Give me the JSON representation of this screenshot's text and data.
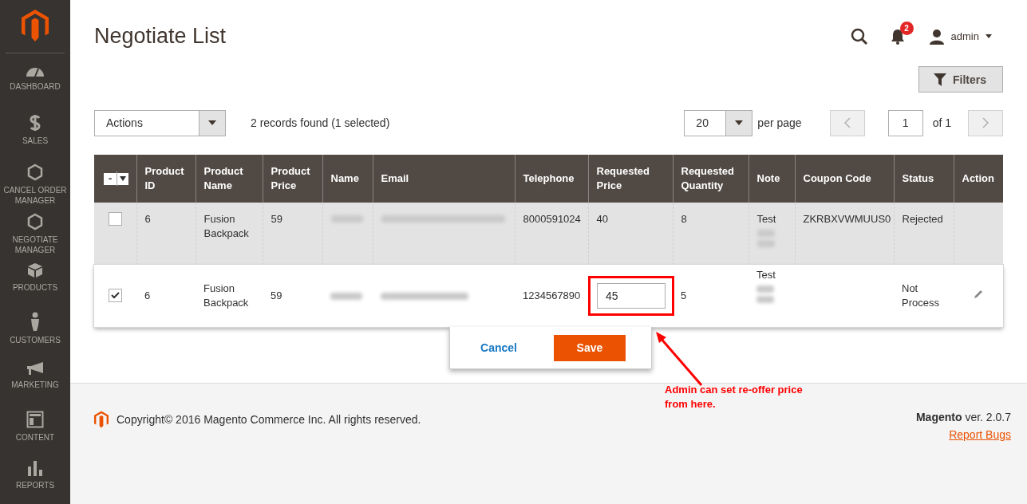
{
  "sidebar": {
    "items": [
      {
        "kind": "dashboard",
        "label": "DASHBOARD"
      },
      {
        "kind": "sales",
        "label": "SALES"
      },
      {
        "kind": "extension",
        "label": "CANCEL ORDER MANAGER"
      },
      {
        "kind": "extension",
        "label": "NEGOTIATE MANAGER"
      },
      {
        "kind": "products",
        "label": "PRODUCTS"
      },
      {
        "kind": "customers",
        "label": "CUSTOMERS"
      },
      {
        "kind": "marketing",
        "label": "MARKETING"
      },
      {
        "kind": "content",
        "label": "CONTENT"
      },
      {
        "kind": "reports",
        "label": "REPORTS"
      }
    ]
  },
  "header": {
    "title": "Negotiate List",
    "notifications": "2",
    "user": "admin"
  },
  "filters_button": "Filters",
  "toolbar": {
    "actions": "Actions",
    "records": "2 records found (1 selected)",
    "per_page_value": "20",
    "per_page_label": "per page",
    "page": "1",
    "of_pages": "of 1"
  },
  "table": {
    "mass_select": "-",
    "columns": [
      "Product ID",
      "Product Name",
      "Product Price",
      "Name",
      "Email",
      "Telephone",
      "Requested Price",
      "Requested Quantity",
      "Note",
      "Coupon Code",
      "Status",
      "Action"
    ],
    "rows": [
      {
        "selected": false,
        "editing": false,
        "product_id": "6",
        "product_name": "Fusion Backpack",
        "product_price": "59",
        "telephone": "8000591024",
        "requested_price": "40",
        "requested_quantity": "8",
        "note": "Test",
        "coupon_code": "ZKRBXVWMUUS0",
        "status": "Rejected"
      },
      {
        "selected": true,
        "editing": true,
        "product_id": "6",
        "product_name": "Fusion Backpack",
        "product_price": "59",
        "telephone": "1234567890",
        "requested_price": "45",
        "requested_quantity": "5",
        "note": "Test",
        "status": "Not Process"
      }
    ]
  },
  "edit_actions": {
    "cancel": "Cancel",
    "save": "Save"
  },
  "annotation": "Admin can set re-offer price from here.",
  "footer": {
    "copyright": "Copyright© 2016 Magento Commerce Inc. All rights reserved.",
    "version": "**Magento** ver. 2.0.7",
    "report_bugs": "Report Bugs"
  }
}
